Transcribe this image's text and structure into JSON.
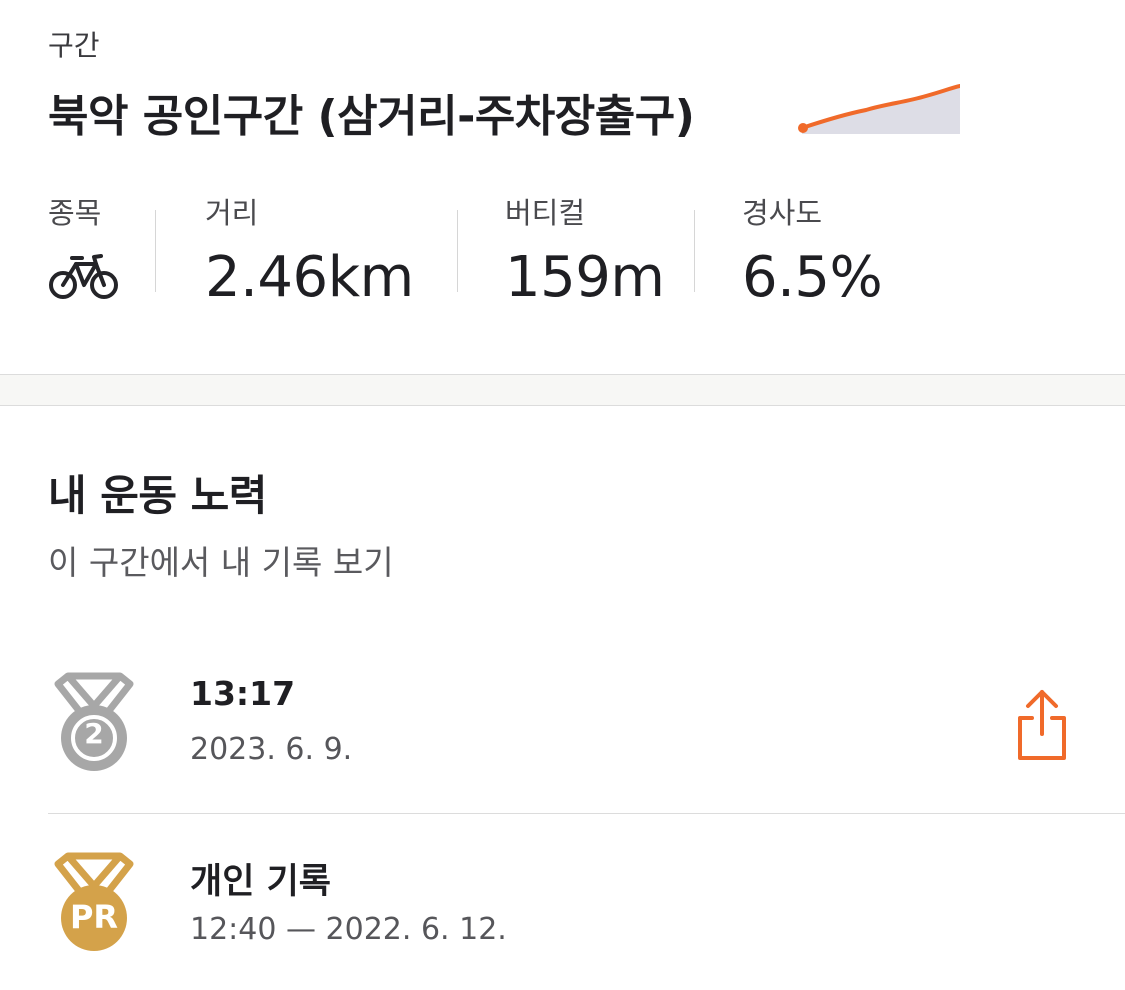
{
  "segment": {
    "label": "구간",
    "title": "북악 공인구간 (삼거리-주차장출구)",
    "elevation_profile": {
      "accent": "#F06A2A",
      "fill": "#DDDDE6"
    }
  },
  "stats": {
    "sport_label": "종목",
    "sport_icon": "bike-icon",
    "distance_label": "거리",
    "distance_value": "2.46km",
    "vertical_label": "버티컬",
    "vertical_value": "159m",
    "grade_label": "경사도",
    "grade_value": "6.5%"
  },
  "efforts": {
    "title": "내 운동 노력",
    "subtitle": "이 구간에서 내 기록 보기",
    "items": [
      {
        "time": "13:17",
        "date": "2023. 6. 9.",
        "medal": "second-place-medal-icon",
        "rank": "2",
        "color": "#A7A7A7"
      },
      {
        "title": "개인 기록",
        "detail": "12:40 — 2022. 6. 12.",
        "medal": "personal-record-medal-icon",
        "badge": "PR",
        "color": "#D4A24A"
      }
    ],
    "share_icon": "share-icon",
    "share_color": "#F06A2A"
  }
}
